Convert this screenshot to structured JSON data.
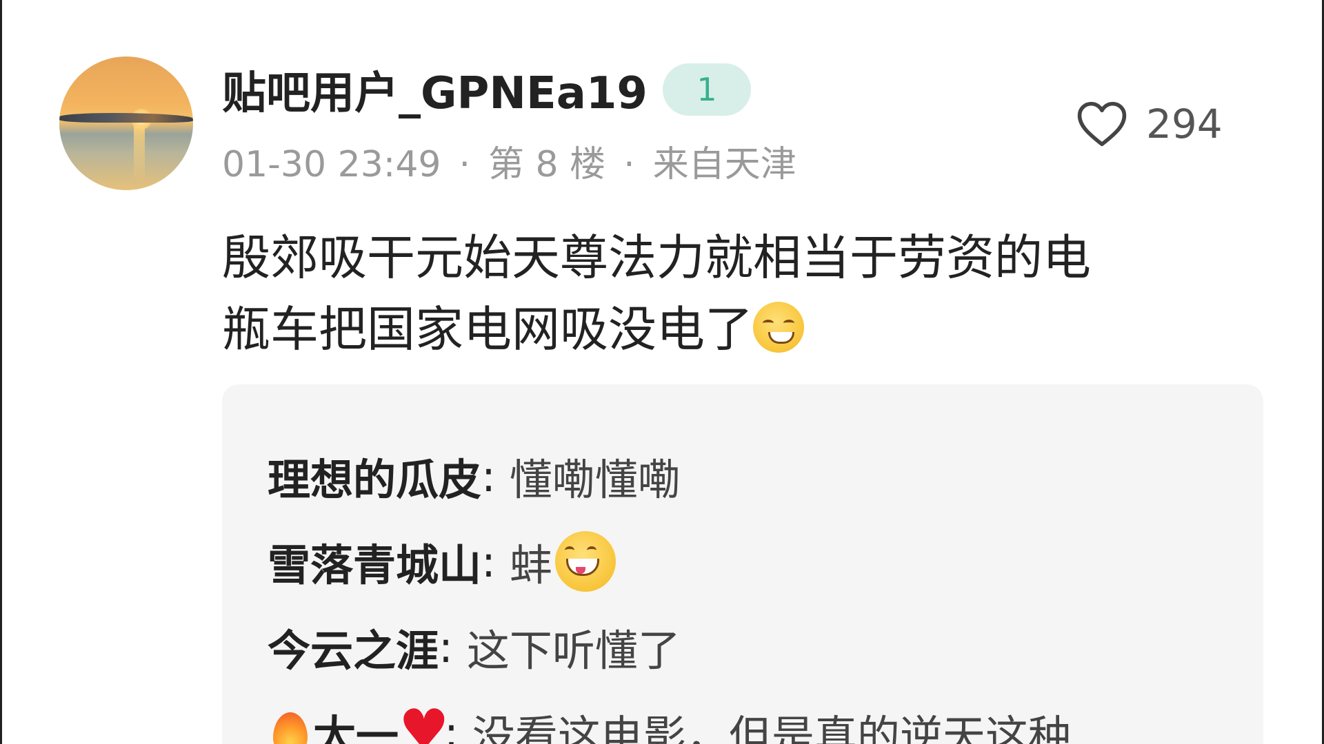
{
  "post": {
    "username": "贴吧用户_GPNEa19",
    "level": "1",
    "date": "01-30 23:49",
    "separator": "·",
    "floor": "第 8 楼",
    "location": "来自天津",
    "like_count": "294",
    "content_line1": "殷郊吸干元始天尊法力就相当于劳资的电",
    "content_line2": "瓶车把国家电网吸没电了",
    "content_emoji": "shy-laugh-emoji"
  },
  "replies": [
    {
      "name": "理想的瓜皮",
      "text": "懂嘞懂嘞"
    },
    {
      "name": "雪落青城山",
      "text": "蚌",
      "emoji": "grin-emoji"
    },
    {
      "name": "今云之涯",
      "text": "这下听懂了"
    },
    {
      "name_prefix_icon": "fire-icon",
      "name": "太一",
      "name_suffix_icon": "red-heart-icon",
      "text": "没看这电影，但是真的逆天这种"
    }
  ],
  "reply_colon": ":",
  "colors": {
    "badge_bg": "#d7efe8",
    "badge_text": "#38b08f",
    "meta_text": "#9a9a9a",
    "reply_bg": "#f5f5f5"
  }
}
